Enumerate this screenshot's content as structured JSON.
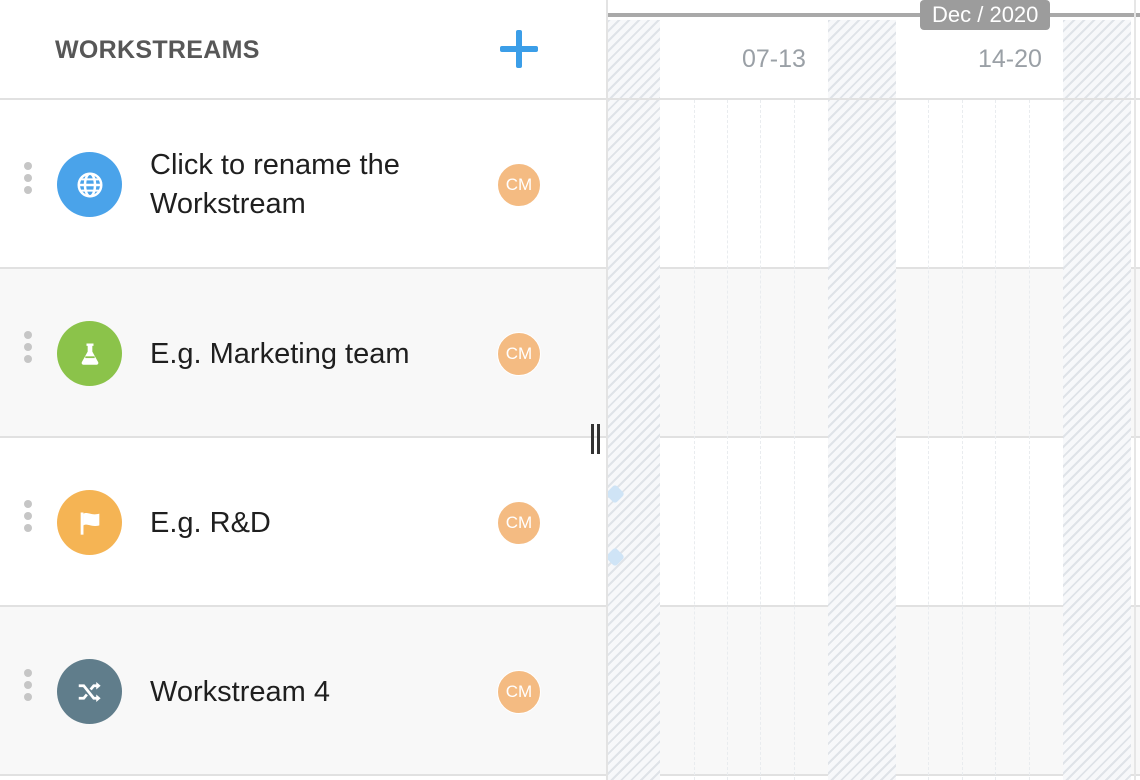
{
  "header": {
    "title": "WORKSTREAMS",
    "add_icon": "plus-icon"
  },
  "workstreams": [
    {
      "name": "Click to rename the Workstream",
      "icon": "globe-icon",
      "color": "#4aa3ea",
      "assignee": "CM"
    },
    {
      "name": "E.g. Marketing team",
      "icon": "flask-icon",
      "color": "#8bc34a",
      "assignee": "CM"
    },
    {
      "name": "E.g. R&D",
      "icon": "flag-icon",
      "color": "#f5b454",
      "assignee": "CM"
    },
    {
      "name": "Workstream 4",
      "icon": "shuffle-icon",
      "color": "#607d8b",
      "assignee": "CM"
    }
  ],
  "timeline": {
    "month": "Dec / 2020",
    "weeks": [
      "07-13",
      "14-20"
    ]
  },
  "colors": {
    "accent": "#3b9ee8",
    "avatar": "#f4bb82"
  }
}
